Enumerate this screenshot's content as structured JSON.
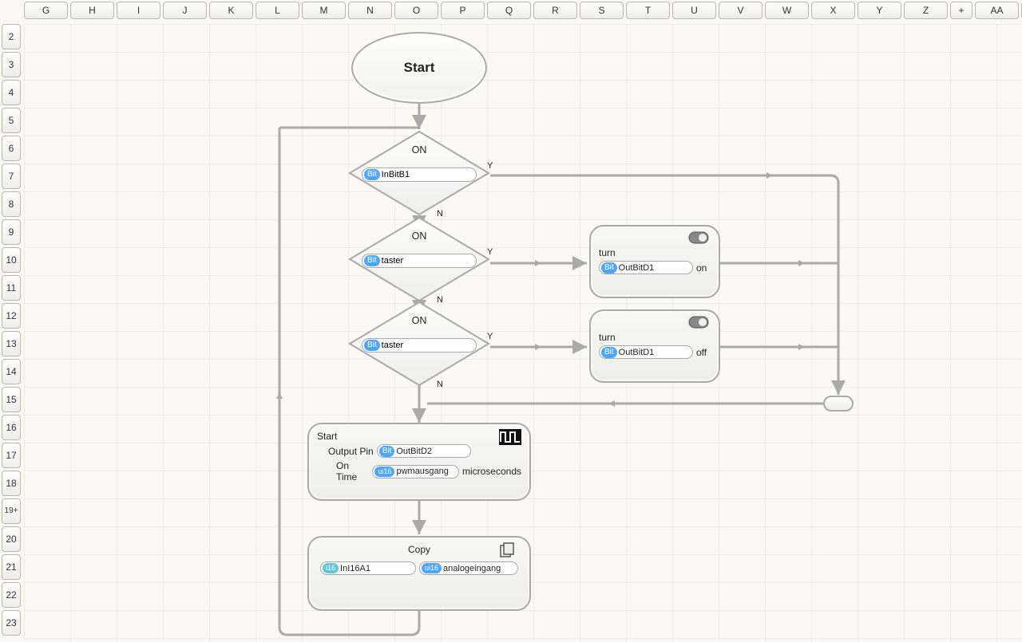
{
  "columns": [
    "G",
    "H",
    "I",
    "J",
    "K",
    "L",
    "M",
    "N",
    "O",
    "P",
    "Q",
    "R",
    "S",
    "T",
    "U",
    "V",
    "W",
    "X",
    "Y",
    "Z",
    "+",
    "AA",
    "A"
  ],
  "rows": [
    "2",
    "3",
    "4",
    "5",
    "6",
    "7",
    "8",
    "9",
    "10",
    "11",
    "12",
    "13",
    "14",
    "15",
    "16",
    "17",
    "18",
    "19+",
    "20",
    "21",
    "22",
    "23"
  ],
  "start": {
    "label": "Start"
  },
  "decision1": {
    "title": "ON",
    "tag": "Bit",
    "value": "InBitB1",
    "y": "Y",
    "n": "N"
  },
  "decision2": {
    "title": "ON",
    "tag": "Bit",
    "value": "taster",
    "y": "Y",
    "n": "N"
  },
  "decision3": {
    "title": "ON",
    "tag": "Bit",
    "value": "taster",
    "y": "Y",
    "n": "N"
  },
  "turn_on": {
    "label": "turn",
    "tag": "Bit",
    "value": "OutBitD1",
    "state": "on"
  },
  "turn_off": {
    "label": "turn",
    "tag": "Bit",
    "value": "OutBitD1",
    "state": "off"
  },
  "pwm": {
    "title": "Start",
    "output_label": "Output Pin",
    "output_tag": "Bit",
    "output_value": "OutBitD2",
    "ontime_label": "On Time",
    "ontime_tag": "ui16",
    "ontime_value": "pwmausgang",
    "unit": "microseconds"
  },
  "copy": {
    "title": "Copy",
    "left_tag": "i16",
    "left_value": "InI16A1",
    "right_tag": "ui16",
    "right_value": "analogeingang"
  }
}
